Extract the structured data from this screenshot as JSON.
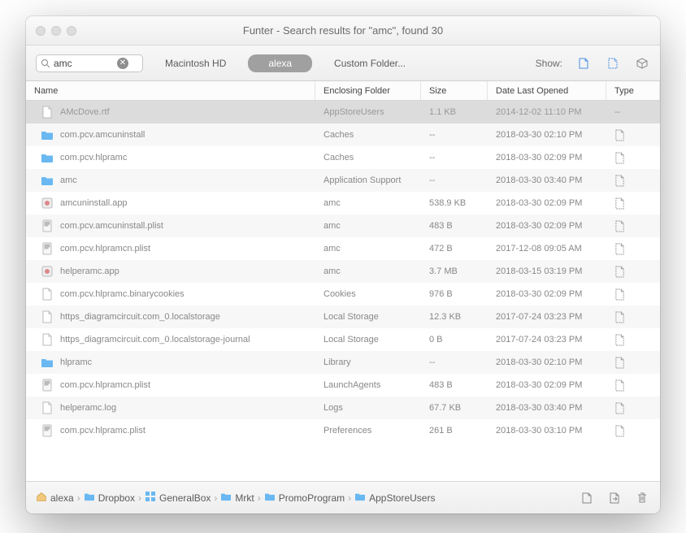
{
  "title": "Funter - Search results for \"amc\", found 30",
  "search": {
    "value": "amc"
  },
  "tabs": {
    "mac": "Macintosh HD",
    "user": "alexa",
    "custom": "Custom Folder..."
  },
  "show_label": "Show:",
  "columns": {
    "name": "Name",
    "folder": "Enclosing Folder",
    "size": "Size",
    "date": "Date Last Opened",
    "type": "Type"
  },
  "rows": [
    {
      "icon": "doc",
      "name": "AMcDove.rtf",
      "folder": "AppStoreUsers",
      "size": "1.1 KB",
      "date": "2014-12-02 11:10 PM",
      "type": "--",
      "sel": true
    },
    {
      "icon": "folder",
      "name": "com.pcv.amcuninstall",
      "folder": "Caches",
      "size": "--",
      "date": "2018-03-30 02:10 PM",
      "type": "doc"
    },
    {
      "icon": "folder",
      "name": "com.pcv.hlpramc",
      "folder": "Caches",
      "size": "--",
      "date": "2018-03-30 02:09 PM",
      "type": "doc"
    },
    {
      "icon": "folder",
      "name": "amc",
      "folder": "Application Support",
      "size": "--",
      "date": "2018-03-30 03:40 PM",
      "type": "doc"
    },
    {
      "icon": "app",
      "name": "amcuninstall.app",
      "folder": "amc",
      "size": "538.9 KB",
      "date": "2018-03-30 02:09 PM",
      "type": "doc"
    },
    {
      "icon": "plist",
      "name": "com.pcv.amcuninstall.plist",
      "folder": "amc",
      "size": "483 B",
      "date": "2018-03-30 02:09 PM",
      "type": "doc"
    },
    {
      "icon": "plist",
      "name": "com.pcv.hlpramcn.plist",
      "folder": "amc",
      "size": "472 B",
      "date": "2017-12-08 09:05 AM",
      "type": "doc"
    },
    {
      "icon": "app",
      "name": "helperamc.app",
      "folder": "amc",
      "size": "3.7 MB",
      "date": "2018-03-15 03:19 PM",
      "type": "doc"
    },
    {
      "icon": "doc",
      "name": "com.pcv.hlpramc.binarycookies",
      "folder": "Cookies",
      "size": "976 B",
      "date": "2018-03-30 02:09 PM",
      "type": "doc"
    },
    {
      "icon": "doc",
      "name": "https_diagramcircuit.com_0.localstorage",
      "folder": "Local Storage",
      "size": "12.3 KB",
      "date": "2017-07-24 03:23 PM",
      "type": "doc"
    },
    {
      "icon": "doc",
      "name": "https_diagramcircuit.com_0.localstorage-journal",
      "folder": "Local Storage",
      "size": "0 B",
      "date": "2017-07-24 03:23 PM",
      "type": "doc"
    },
    {
      "icon": "folder",
      "name": "hlpramc",
      "folder": "Library",
      "size": "--",
      "date": "2018-03-30 02:10 PM",
      "type": "doc"
    },
    {
      "icon": "plist",
      "name": "com.pcv.hlpramcn.plist",
      "folder": "LaunchAgents",
      "size": "483 B",
      "date": "2018-03-30 02:09 PM",
      "type": "doc"
    },
    {
      "icon": "doc",
      "name": "helperamc.log",
      "folder": "Logs",
      "size": "67.7 KB",
      "date": "2018-03-30 03:40 PM",
      "type": "doc"
    },
    {
      "icon": "plist",
      "name": "com.pcv.hlpramc.plist",
      "folder": "Preferences",
      "size": "261 B",
      "date": "2018-03-30 03:10 PM",
      "type": "doc"
    }
  ],
  "path": [
    {
      "icon": "home",
      "label": "alexa"
    },
    {
      "icon": "folder",
      "label": "Dropbox"
    },
    {
      "icon": "grid",
      "label": "GeneralBox"
    },
    {
      "icon": "folder",
      "label": "Mrkt"
    },
    {
      "icon": "folder",
      "label": "PromoProgram"
    },
    {
      "icon": "folder",
      "label": "AppStoreUsers"
    }
  ]
}
